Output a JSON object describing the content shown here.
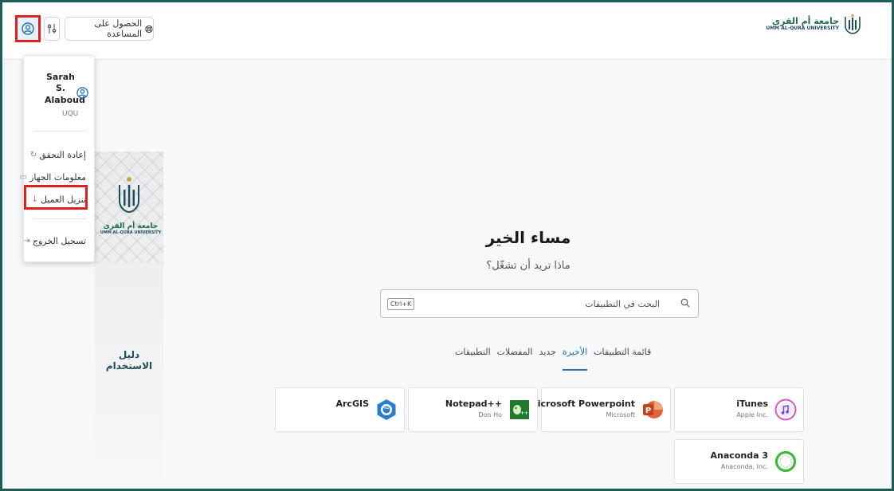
{
  "header": {
    "help_label": "الحصول على المساعدة",
    "logo_ar": "جامعة أم القرى",
    "logo_en": "UMM AL-QURA UNIVERSITY",
    "user_icon": "user-circle-icon",
    "preferences_icon": "sliders-icon",
    "help_icon": "lifebuoy-icon"
  },
  "user_menu": {
    "name": "Sarah S. Alaboud",
    "org": "UQU",
    "items": [
      {
        "label": "إعادة التحقق",
        "icon": "refresh-icon"
      },
      {
        "label": "معلومات الجهاز",
        "icon": "monitor-icon"
      },
      {
        "label": "تنزيل العميل",
        "icon": "download-icon"
      },
      {
        "label": "تسجيل الخروج",
        "icon": "logout-icon"
      }
    ]
  },
  "banner": {
    "logo_ar": "جامعة أم القرى",
    "logo_en": "UMM AL-QURA UNIVERSITY",
    "guide_label": "دليل الاستخدام"
  },
  "main": {
    "greeting": "مساء الخير",
    "question": "ماذا تريد أن تشغّل؟",
    "search": {
      "placeholder": "البحث في التطبيقات",
      "shortcut": "Ctrl+K"
    },
    "tabs": [
      "التطبيقات",
      "المفضلات",
      "جديد",
      "الأخيرة",
      "قائمة التطبيقات"
    ],
    "active_tab": "الأخيرة",
    "apps": [
      {
        "name": "iTunes",
        "publisher": "Apple Inc.",
        "icon": "itunes-icon"
      },
      {
        "name": "Microsoft Powerpoint",
        "publisher": "Microsoft",
        "icon": "powerpoint-icon"
      },
      {
        "name": "Notepad++",
        "publisher": "Don Ho",
        "icon": "notepadpp-icon"
      },
      {
        "name": "ArcGIS",
        "publisher": "",
        "icon": "arcgis-icon"
      },
      {
        "name": "Anaconda 3",
        "publisher": "Anaconda, Inc.",
        "icon": "anaconda-icon"
      }
    ]
  },
  "colors": {
    "frame": "#1d5c57",
    "highlight": "#e02020",
    "accent": "#1f6fb5"
  }
}
